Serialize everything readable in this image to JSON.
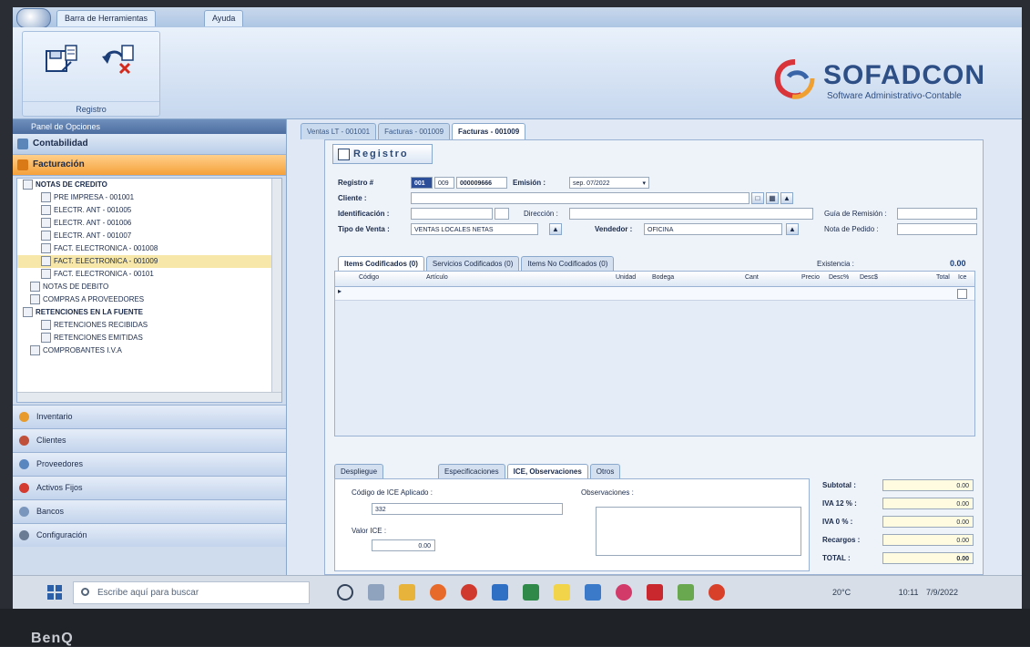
{
  "ribbon": {
    "tabs": [
      "Barra de Herramientas",
      "Ayuda"
    ],
    "group_label": "Registro",
    "buttons": [
      {
        "icon": "save-record-icon"
      },
      {
        "icon": "undo-cancel-icon"
      }
    ]
  },
  "logo": {
    "text": "SOFADCON",
    "subtitle": "Software Administrativo-Contable"
  },
  "nav": {
    "header": "Panel de Opciones",
    "groups": [
      "Contabilidad",
      "Facturación"
    ],
    "tree": [
      {
        "label": "NOTAS DE CREDITO",
        "level": 0
      },
      {
        "label": "PRE IMPRESA - 001001",
        "level": 1
      },
      {
        "label": "ELECTR. ANT - 001005",
        "level": 1
      },
      {
        "label": "ELECTR. ANT - 001006",
        "level": 1
      },
      {
        "label": "ELECTR. ANT - 001007",
        "level": 1
      },
      {
        "label": "FACT. ELECTRONICA - 001008",
        "level": 1
      },
      {
        "label": "FACT. ELECTRONICA - 001009",
        "level": 1,
        "selected": true
      },
      {
        "label": "FACT. ELECTRONICA - 00101",
        "level": 1
      },
      {
        "label": "NOTAS DE DEBITO",
        "level": 2
      },
      {
        "label": "COMPRAS A PROVEEDORES",
        "level": 2
      },
      {
        "label": "RETENCIONES EN LA FUENTE",
        "level": 0
      },
      {
        "label": "RETENCIONES RECIBIDAS",
        "level": 1
      },
      {
        "label": "RETENCIONES EMITIDAS",
        "level": 1
      },
      {
        "label": "COMPROBANTES I.V.A",
        "level": 2
      }
    ],
    "buttons": [
      "Inventario",
      "Clientes",
      "Proveedores",
      "Activos Fijos",
      "Bancos",
      "Configuración"
    ]
  },
  "main": {
    "doc_tabs": [
      "Ventas LT - 001001",
      "Facturas - 001009",
      "Facturas - 001009"
    ],
    "form_title": "Registro",
    "registro": {
      "label": "Registro #",
      "serie1": "001",
      "serie2": "009",
      "number": "000009666"
    },
    "emision": {
      "label": "Emisión :",
      "value": "sep. 07/2022"
    },
    "cliente": {
      "label": "Cliente :",
      "value": ""
    },
    "identificacion": {
      "label": "Identificación :",
      "value": ""
    },
    "direccion": {
      "label": "Dirección :",
      "value": ""
    },
    "guia": {
      "label": "Guía de Remisión :",
      "value": ""
    },
    "tipo_venta": {
      "label": "Tipo de Venta :",
      "value": "VENTAS LOCALES NETAS"
    },
    "vendedor": {
      "label": "Vendedor :",
      "value": "OFICINA"
    },
    "nota_pedido": {
      "label": "Nota de Pedido :",
      "value": ""
    },
    "item_tabs": [
      "Items Codificados (0)",
      "Servicios Codificados (0)",
      "Items No Codificados (0)"
    ],
    "existencia": {
      "label": "Existencia :",
      "value": "0.00"
    },
    "grid_headers": [
      "Código",
      "Artículo",
      "Unidad",
      "Bodega",
      "Cant",
      "Precio",
      "Desc%",
      "Desc$",
      "Total",
      "Ice"
    ],
    "bottom_tabs": [
      "Despliegue",
      "Especificaciones",
      "ICE, Observaciones",
      "Otros"
    ],
    "ice": {
      "codigo_label": "Código de ICE Aplicado :",
      "codigo_value": "332",
      "valor_label": "Valor ICE :",
      "valor_value": "0.00",
      "obs_label": "Observaciones :"
    },
    "totals": [
      {
        "label": "Subtotal :",
        "value": "0.00"
      },
      {
        "label": "IVA 12 % :",
        "value": "0.00"
      },
      {
        "label": "IVA 0 % :",
        "value": "0.00"
      },
      {
        "label": "Recargos :",
        "value": "0.00"
      },
      {
        "label": "TOTAL :",
        "value": "0.00"
      }
    ]
  },
  "taskbar": {
    "search_placeholder": "Escribe aquí para buscar",
    "temp": "20°C",
    "time": "10:11",
    "date": "7/9/2022"
  },
  "bezel": {
    "brand": "BenQ"
  }
}
